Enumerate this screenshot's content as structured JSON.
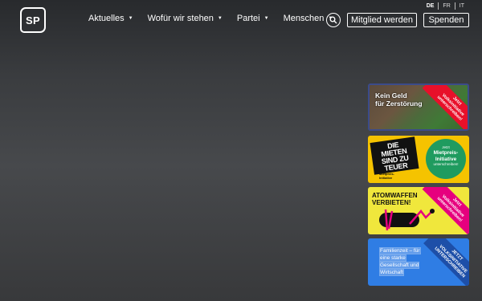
{
  "logo": {
    "text": "SP"
  },
  "nav": [
    {
      "label": "Aktuelles"
    },
    {
      "label": "Wofür wir stehen"
    },
    {
      "label": "Partei"
    },
    {
      "label": "Menschen"
    }
  ],
  "languages": [
    "DE",
    "FR",
    "IT"
  ],
  "header": {
    "search_icon": "search-icon",
    "member_button": "Mitglied werden",
    "donate_button": "Spenden"
  },
  "cards": [
    {
      "title_line1": "Kein Geld",
      "title_line2": "für Zerstörung",
      "ribbon_line1": "Jetzt",
      "ribbon_line2": "Volksinitiative",
      "ribbon_line3": "unterschreiben!"
    },
    {
      "headline_line1": "DIE",
      "headline_line2": "MIETEN",
      "headline_line3": "SIND ZU",
      "headline_line4": "TEUER",
      "sub_line1": "Mietpreis-",
      "sub_line2": "Initiative",
      "circle_small_top": "Jetzt",
      "circle_line1": "Mietpreis-",
      "circle_line2": "Initiative",
      "circle_small_bottom": "unterschreiben!"
    },
    {
      "title_line1": "ATOMWAFFEN",
      "title_line2": "VERBIETEN!",
      "ribbon_line1": "Jetzt",
      "ribbon_line2": "Volksinitiative",
      "ribbon_line3": "unterschreiben!"
    },
    {
      "text_line1": "Familienzeit – für",
      "text_line2": "eine starke",
      "text_line3": "Gesellschaft und",
      "text_line4": "Wirtschaft",
      "ribbon_line1": "JETZT",
      "ribbon_line2": "VOLKSINITIATIVE",
      "ribbon_line3": "UNTERSCHREIBEN"
    }
  ],
  "colors": {
    "background": "#3a3c3f",
    "accent_red": "#e8102a",
    "mieten_yellow": "#f5c300",
    "atom_yellow": "#f0e73c",
    "family_blue": "#2f7de4",
    "green": "#1f9b5f",
    "pink": "#e6007e"
  }
}
